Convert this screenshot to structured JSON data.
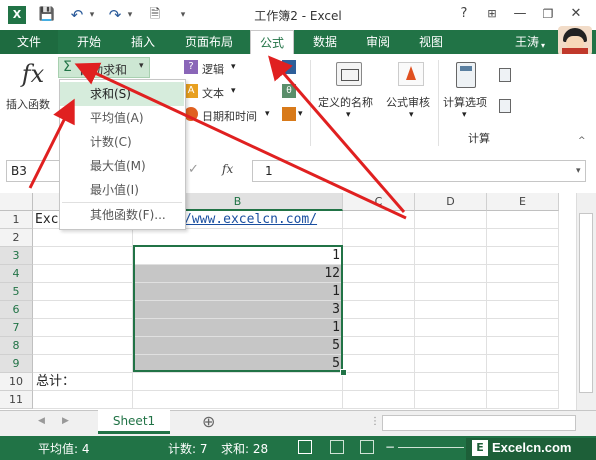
{
  "window": {
    "title": "工作簿2 - Excel",
    "help": "?",
    "minimize": "—",
    "restore": "❐",
    "close": "✕",
    "options": "⊞"
  },
  "quick_access": {
    "save": "💾",
    "undo": "↶",
    "redo": "↷",
    "preview": "🗎"
  },
  "tabs": [
    "文件",
    "开始",
    "插入",
    "页面布局",
    "公式",
    "数据",
    "审阅",
    "视图"
  ],
  "user": "王涛",
  "ribbon": {
    "fx_symbol": "fx",
    "insert_function": "插入函数",
    "autosum": "自动求和",
    "autosum_symbol": "Σ",
    "logical": "逻辑",
    "text": "文本",
    "datetime": "日期和时间",
    "defined_names": "定义的名称",
    "formula_auditing": "公式审核",
    "calc_options": "计算选项",
    "calc_group": "计算"
  },
  "autosum_menu": [
    "求和(S)",
    "平均值(A)",
    "计数(C)",
    "最大值(M)",
    "最小值(I)",
    "其他函数(F)..."
  ],
  "formula_bar": {
    "cell_ref": "B3",
    "cancel": "✕",
    "enter": "✓",
    "fx": "fx",
    "value": "1"
  },
  "columns": [
    "A",
    "B",
    "C",
    "D",
    "E"
  ],
  "rows": [
    "1",
    "2",
    "3",
    "4",
    "5",
    "6",
    "7",
    "8",
    "9",
    "10",
    "11"
  ],
  "cells": {
    "A1": "Exc",
    "B1": "/www.excelcn.com/",
    "A10": "总计：",
    "B_values": [
      "1",
      "12",
      "1",
      "3",
      "1",
      "5",
      "5"
    ]
  },
  "sheet": {
    "name": "Sheet1",
    "add": "⊕",
    "prev": "◀",
    "next": "▶"
  },
  "status": {
    "average": "平均值: 4",
    "count": "计数: 7",
    "sum": "求和: 28"
  },
  "watermark": "Excelcn.com",
  "colors": {
    "excel_green": "#217346",
    "selection": "#c6c6c6",
    "arrow": "#e02020"
  }
}
